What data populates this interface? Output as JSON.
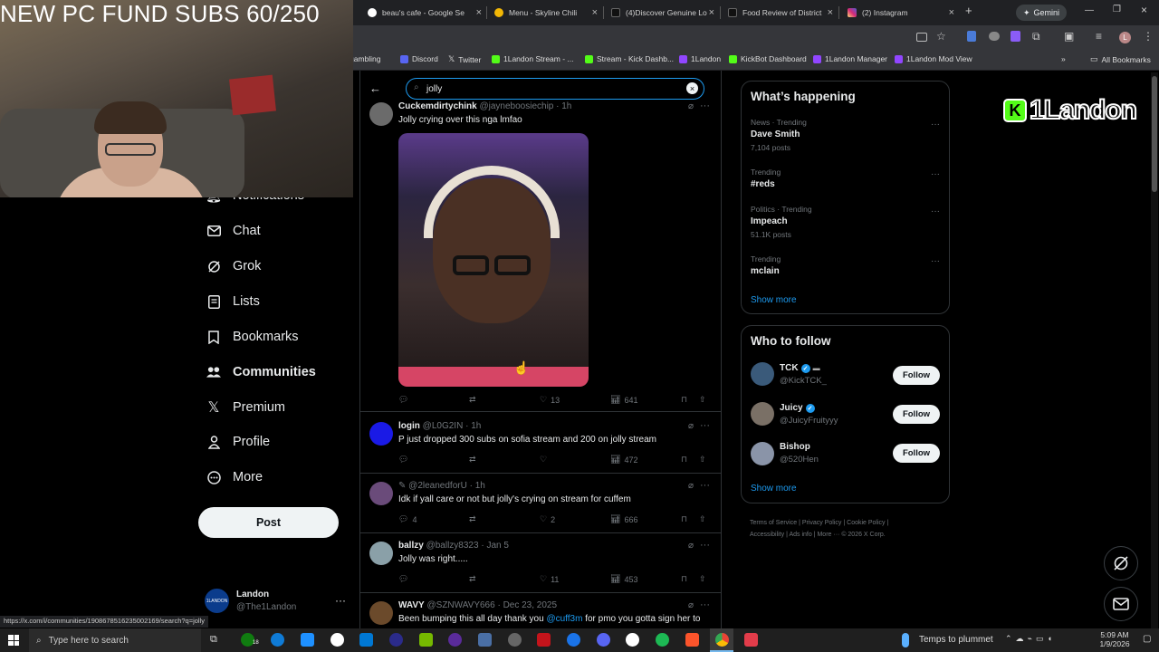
{
  "browser": {
    "tabs": [
      {
        "title": "beau's cafe - Google Se",
        "color": "#4285f4"
      },
      {
        "title": "Menu - Skyline Chili",
        "color": "#f2b705"
      },
      {
        "title": "(4)Discover Genuine Lo",
        "color": "#222222"
      },
      {
        "title": "Food Review of District",
        "color": "#222222"
      },
      {
        "title": "(2) Instagram",
        "color": "#d6249f"
      }
    ],
    "gemini_label": "Gemini",
    "bookmarks": [
      "gambling",
      "Discord",
      "Twitter",
      "1Landon Stream - ...",
      "Stream - Kick Dashb...",
      "1Landon",
      "KickBot Dashboard",
      "1Landon Manager",
      "1Landon Mod View"
    ],
    "all_bookmarks": "All Bookmarks"
  },
  "overlay": {
    "webcam_title": "NEW PC FUND SUBS 60/250",
    "brand_logo": "1Landon"
  },
  "sidebar": {
    "items": [
      {
        "label": "Notifications",
        "icon": "bell-icon"
      },
      {
        "label": "Chat",
        "icon": "mail-icon"
      },
      {
        "label": "Grok",
        "icon": "grok-icon"
      },
      {
        "label": "Lists",
        "icon": "list-icon"
      },
      {
        "label": "Bookmarks",
        "icon": "bookmark-icon"
      },
      {
        "label": "Communities",
        "icon": "people-icon"
      },
      {
        "label": "Premium",
        "icon": "x-logo-icon"
      },
      {
        "label": "Profile",
        "icon": "person-icon"
      },
      {
        "label": "More",
        "icon": "more-circle-icon"
      }
    ],
    "post_label": "Post",
    "account": {
      "name": "Landon",
      "handle": "@The1Landon"
    }
  },
  "search": {
    "query": "jolly"
  },
  "tweets": [
    {
      "name": "Cuckemdirtychink",
      "handle": "@jayneboosiechip",
      "time": "1h",
      "text": "Jolly crying over this nga lmfao",
      "replies": "",
      "reposts": "",
      "likes": "13",
      "views": "641"
    },
    {
      "name": "login",
      "handle": "@L0G2IN",
      "time": "1h",
      "text": "P just dropped 300 subs on sofia stream and 200 on jolly stream",
      "replies": "",
      "reposts": "",
      "likes": "",
      "views": "472"
    },
    {
      "name": "",
      "handle": "@2leanedforU",
      "time": "1h",
      "text": "Idk if yall care or not but jolly's crying on stream for cuffem",
      "replies": "4",
      "reposts": "",
      "likes": "2",
      "views": "666"
    },
    {
      "name": "ballzy",
      "handle": "@ballzy8323",
      "time": "Jan 5",
      "text": "Jolly was right.....",
      "replies": "",
      "reposts": "",
      "likes": "11",
      "views": "453"
    },
    {
      "name": "WAVY",
      "handle": "@SZNWAVY666",
      "time": "Dec 23, 2025",
      "text_prefix": "Been bumping this all day thank you ",
      "mention": "@cuff3m",
      "text_suffix": " for pmo you gotta sign her to"
    }
  ],
  "whats_happening": {
    "title": "What’s happening",
    "trends": [
      {
        "category": "News · Trending",
        "name": "Dave Smith",
        "posts": "7,104 posts"
      },
      {
        "category": "Trending",
        "name": "#reds",
        "posts": ""
      },
      {
        "category": "Politics · Trending",
        "name": "Impeach",
        "posts": "51.1K posts"
      },
      {
        "category": "Trending",
        "name": "mclain",
        "posts": ""
      }
    ],
    "show_more": "Show more"
  },
  "who_to_follow": {
    "title": "Who to follow",
    "accounts": [
      {
        "name": "TCK",
        "handle": "@KickTCK_"
      },
      {
        "name": "Juicy",
        "handle": "@JuicyFruityyy"
      },
      {
        "name": "Bishop",
        "handle": "@520Hen"
      }
    ],
    "follow_label": "Follow",
    "show_more": "Show more"
  },
  "footer_links": [
    "Terms of Service",
    "Privacy Policy",
    "Cookie Policy",
    "Accessibility",
    "Ads info",
    "More ···",
    "© 2026 X Corp."
  ],
  "status_url": "https://x.com/i/communities/1908678516235002169/search?q=jolly",
  "taskbar": {
    "search_placeholder": "Type here to search",
    "weather": "Temps to plummet",
    "time": "5:09 AM",
    "date": "1/9/2026",
    "badge": "18"
  }
}
